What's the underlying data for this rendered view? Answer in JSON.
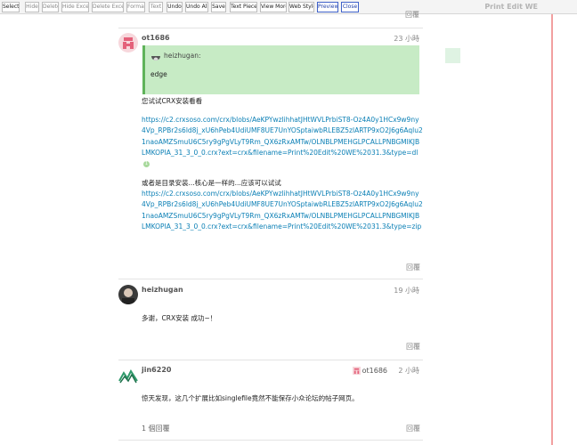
{
  "toolbar": {
    "buttons": [
      {
        "label": "Select",
        "style": "normal"
      },
      {
        "label": "Hide",
        "style": "muted"
      },
      {
        "label": "Delete",
        "style": "muted"
      },
      {
        "label": "Hide Except",
        "style": "muted"
      },
      {
        "label": "Delete Except",
        "style": "muted"
      },
      {
        "label": "Format",
        "style": "muted"
      },
      {
        "label": "Text",
        "style": "muted"
      },
      {
        "label": "Undo",
        "style": "normal"
      },
      {
        "label": "Undo All",
        "style": "normal"
      },
      {
        "label": "Save",
        "style": "normal"
      },
      {
        "label": "Text Pieces",
        "style": "normal"
      },
      {
        "label": "View More",
        "style": "normal"
      },
      {
        "label": "Web Style",
        "style": "normal"
      },
      {
        "label": "Preview",
        "style": "blue"
      },
      {
        "label": "Close",
        "style": "blue"
      }
    ],
    "title": "Print Edit WE"
  },
  "top_reply_label": "回覆",
  "posts": [
    {
      "username": "ot1686",
      "time": "23 小時",
      "quote": {
        "username": "heizhugan:",
        "text": "edge"
      },
      "text1": "您试试CRX安装看看",
      "link1": "https://c2.crxsoso.com/crx/blobs/AeKPYwzlihhatJHtWVLPrbiST8-Oz4A0y1HCx9w9ny4Vp_RPBr2s6ld8j_xU6hPeb4UdiUMF8UE7UnYOSptaiwbRLEBZ5zlARTP9xO2J6g6Aqlu21naoAMZSmuU6C5ry9gPgVLyT9Rm_QX6zRxAMTw/OLNBLPMEHGLPCALLPNBGMIKJBLMKOPIA_31_3_0_0.crx?ext=crx&filename=Print%20Edit%20WE%2031.3&type=dl",
      "link1_clicks": "1",
      "text2": "或者是目录安装...核心是一样的...应该可以试试",
      "link2": "https://c2.crxsoso.com/crx/blobs/AeKPYwzlihhatJHtWVLPrbiST8-Oz4A0y1HCx9w9ny4Vp_RPBr2s6ld8j_xU6hPeb4UdiUMF8UE7UnYOSptaiwbRLEBZ5zlARTP9xO2J6g6Aqlu21naoAMZSmuU6C5ry9gPgVLyT9Rm_QX6zRxAMTw/OLNBLPMEHGLPCALLPNBGMIKJBLMKOPIA_31_3_0_0.crx?ext=crx&filename=Print%20Edit%20WE%2031.3&type=zip",
      "reply_label": "回覆"
    },
    {
      "username": "heizhugan",
      "time": "19 小時",
      "text": "多谢，CRX安装 成功~！",
      "reply_label": "回覆"
    },
    {
      "username": "jin6220",
      "time": "2 小時",
      "reply_to": "ot1686",
      "text": "惊天发现，这几个扩展比如singlefile竟然不能保存小众论坛的帖子网页。",
      "replies": "1 個回覆",
      "reply_label": "回覆"
    }
  ]
}
